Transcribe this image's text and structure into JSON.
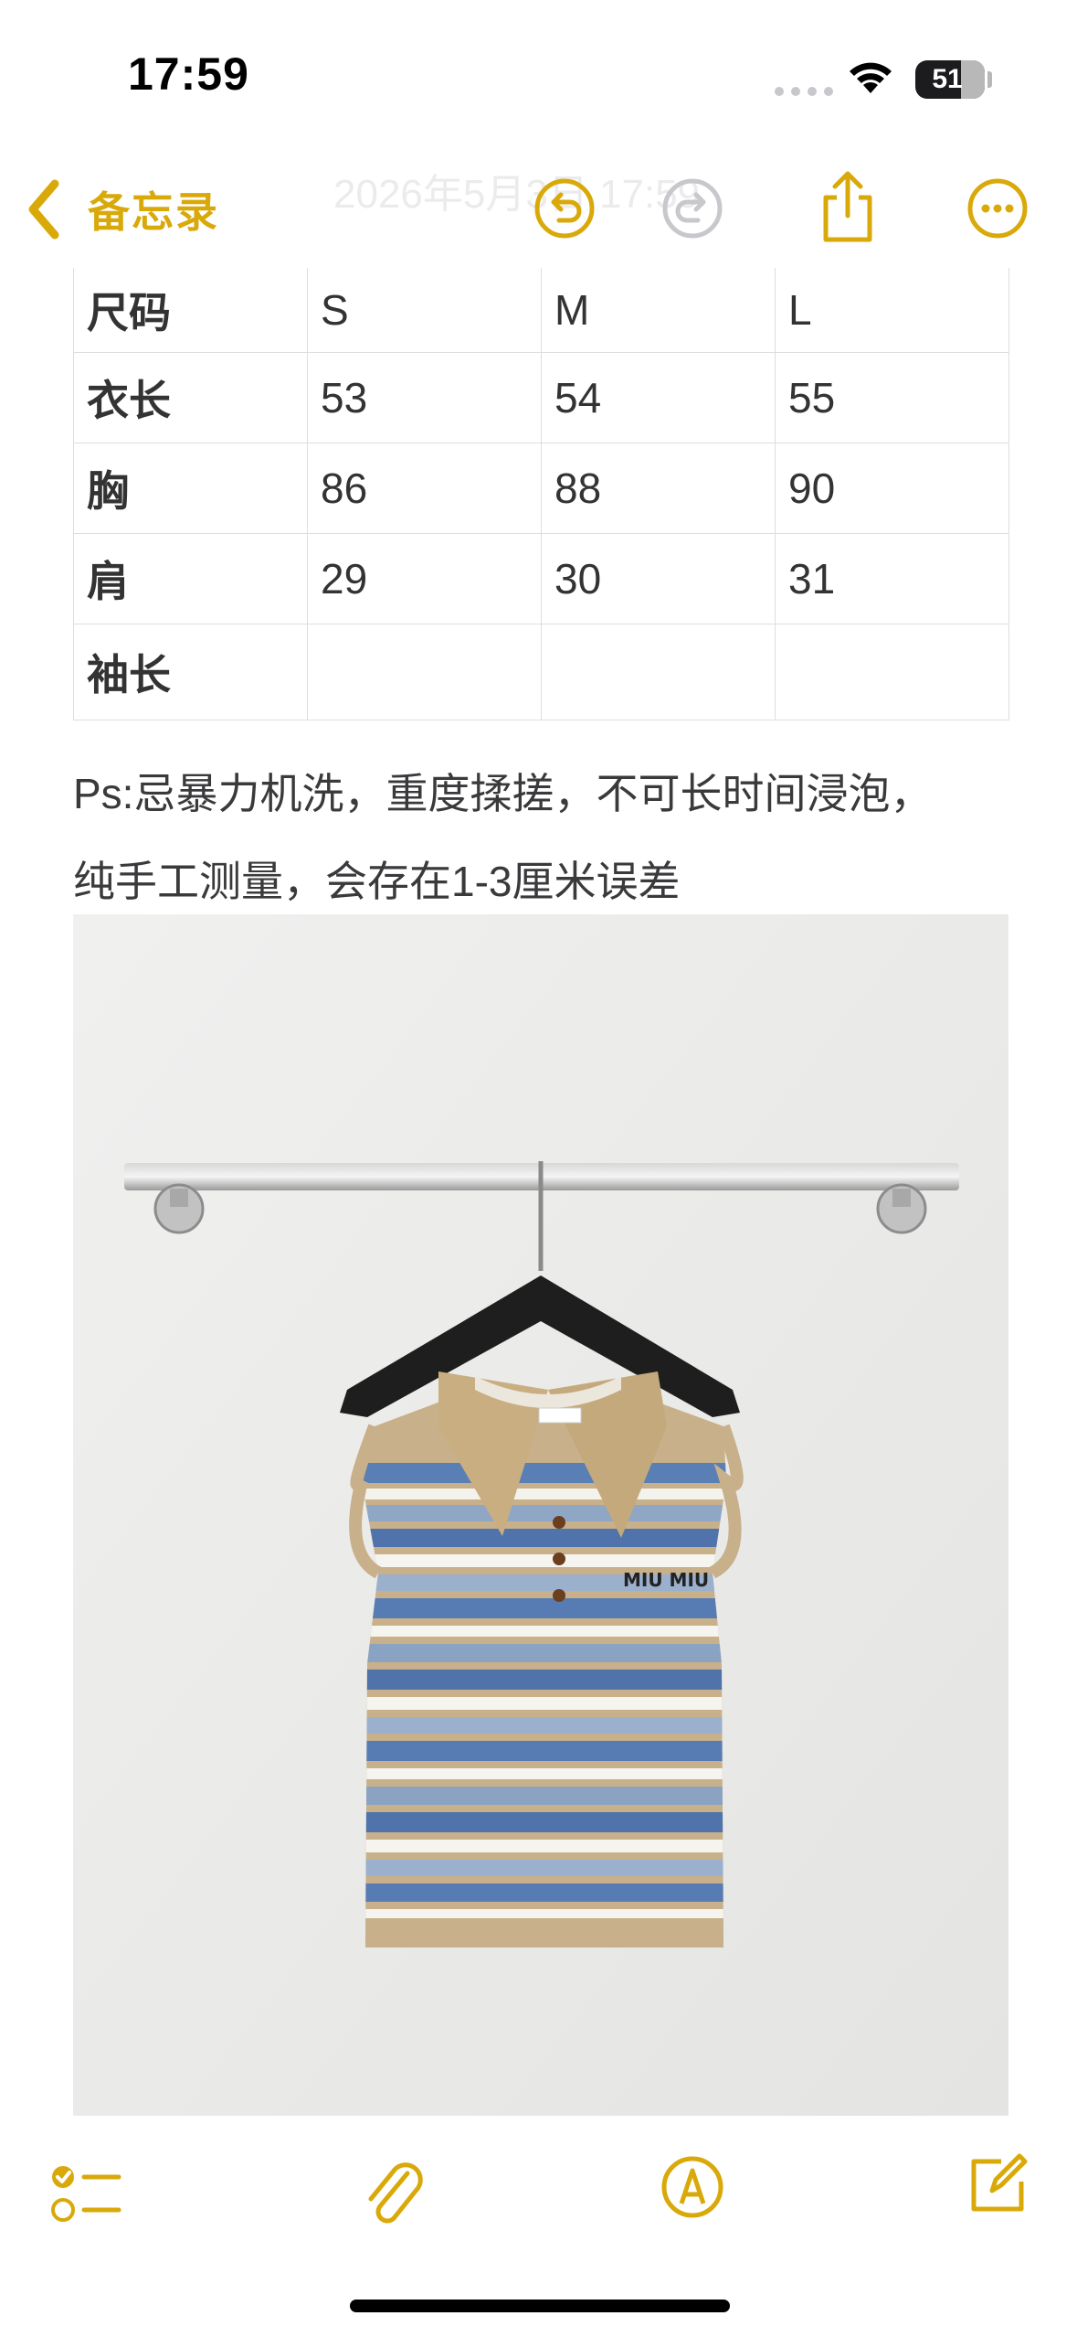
{
  "status_bar": {
    "time": "17:59",
    "battery": "51"
  },
  "nav": {
    "back_label": "备忘录",
    "date_faded": "2026年5月3日 17:59"
  },
  "table": {
    "rows": [
      [
        "尺码",
        "S",
        "M",
        "L"
      ],
      [
        "衣长",
        "53",
        "54",
        "55"
      ],
      [
        "胸",
        "86",
        "88",
        "90"
      ],
      [
        "肩",
        "29",
        "30",
        "31"
      ],
      [
        "袖长",
        "",
        "",
        ""
      ]
    ]
  },
  "note": {
    "line1": "Ps:忌暴力机洗，重度揉搓，不可长时间浸泡，",
    "line2": "纯手工测量，会存在1-3厘米误差"
  },
  "photo": {
    "logo_text": "miu miu"
  },
  "colors": {
    "accent": "#d9a90a",
    "disabled": "#c7c7cc"
  },
  "icons": {
    "back": "chevron-left-icon",
    "undo": "undo-icon",
    "redo": "redo-icon",
    "share": "share-icon",
    "more": "more-icon",
    "checklist": "checklist-icon",
    "attachment": "paperclip-icon",
    "markup": "markup-pen-icon",
    "compose": "compose-icon"
  }
}
